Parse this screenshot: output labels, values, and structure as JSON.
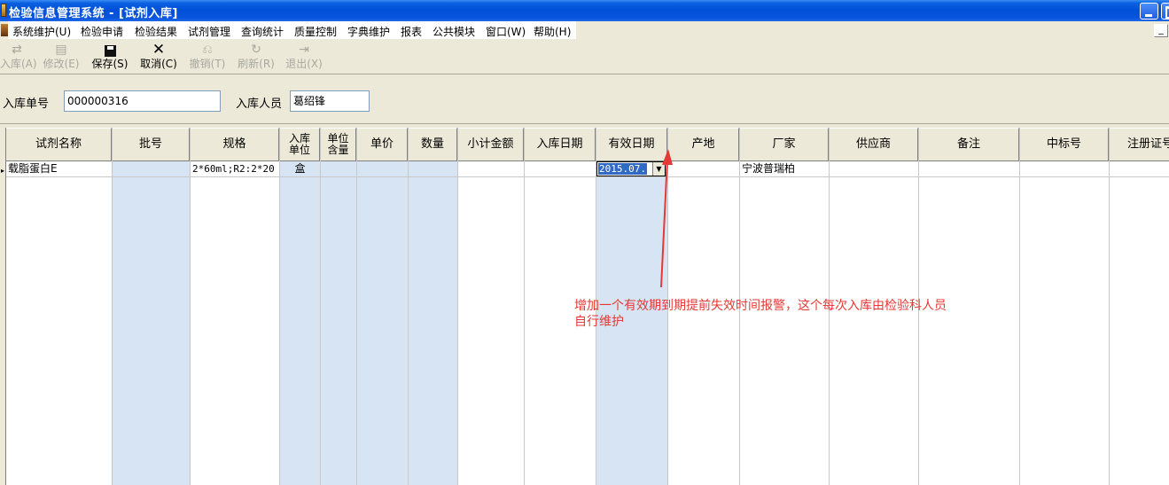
{
  "window": {
    "title": "检验信息管理系统 - [试剂入库]"
  },
  "menu": {
    "items": [
      {
        "label": "系统维护(U)"
      },
      {
        "label": "检验申请"
      },
      {
        "label": "检验结果"
      },
      {
        "label": "试剂管理"
      },
      {
        "label": "查询统计"
      },
      {
        "label": "质量控制"
      },
      {
        "label": "字典维护"
      },
      {
        "label": "报表"
      },
      {
        "label": "公共模块"
      },
      {
        "label": "窗口(W)"
      },
      {
        "label": "帮助(H)"
      }
    ],
    "mdi_minimize": "_"
  },
  "toolbar": {
    "buttons": [
      {
        "label": "入库(A)",
        "icon": "stock-in-icon",
        "enabled": false
      },
      {
        "label": "修改(E)",
        "icon": "edit-icon",
        "enabled": false
      },
      {
        "label": "保存(S)",
        "icon": "save-icon",
        "enabled": true
      },
      {
        "label": "取消(C)",
        "icon": "cancel-icon",
        "enabled": true
      },
      {
        "label": "撤销(T)",
        "icon": "undo-icon",
        "enabled": false
      },
      {
        "label": "刷新(R)",
        "icon": "refresh-icon",
        "enabled": false
      },
      {
        "label": "退出(X)",
        "icon": "exit-icon",
        "enabled": false
      }
    ]
  },
  "form": {
    "order_no_label": "入库单号",
    "order_no_value": "000000316",
    "operator_label": "入库人员",
    "operator_value": "葛绍锋"
  },
  "grid": {
    "columns": [
      {
        "header": "试剂名称",
        "shaded": false
      },
      {
        "header": "批号",
        "shaded": true
      },
      {
        "header": "规格",
        "shaded": false
      },
      {
        "header": "入库单位",
        "shaded": true
      },
      {
        "header": "单位含量",
        "shaded": true
      },
      {
        "header": "单价",
        "shaded": true
      },
      {
        "header": "数量",
        "shaded": true
      },
      {
        "header": "小计金额",
        "shaded": false
      },
      {
        "header": "入库日期",
        "shaded": false
      },
      {
        "header": "有效日期",
        "shaded": true
      },
      {
        "header": "产地",
        "shaded": false
      },
      {
        "header": "厂家",
        "shaded": false
      },
      {
        "header": "供应商",
        "shaded": false
      },
      {
        "header": "备注",
        "shaded": false
      },
      {
        "header": "中标号",
        "shaded": false
      },
      {
        "header": "注册证号",
        "shaded": false
      }
    ],
    "rows": [
      {
        "reagent_name": "载脂蛋白E",
        "batch_no": "",
        "spec": "2*60ml;R2:2*20",
        "unit": "盒",
        "unit_content": "",
        "unit_price": "",
        "quantity": "",
        "subtotal": "",
        "stock_in_date": "",
        "expiry_date": "2015.07.",
        "origin": "",
        "manufacturer": "宁波普瑞柏",
        "supplier": "",
        "remark": "",
        "bid_no": "",
        "reg_no": ""
      }
    ]
  },
  "annotation": {
    "color": "#e53935",
    "text": "增加一个有效期到期提前失效时间报警，这个每次入库由检验科人员自行维护"
  }
}
